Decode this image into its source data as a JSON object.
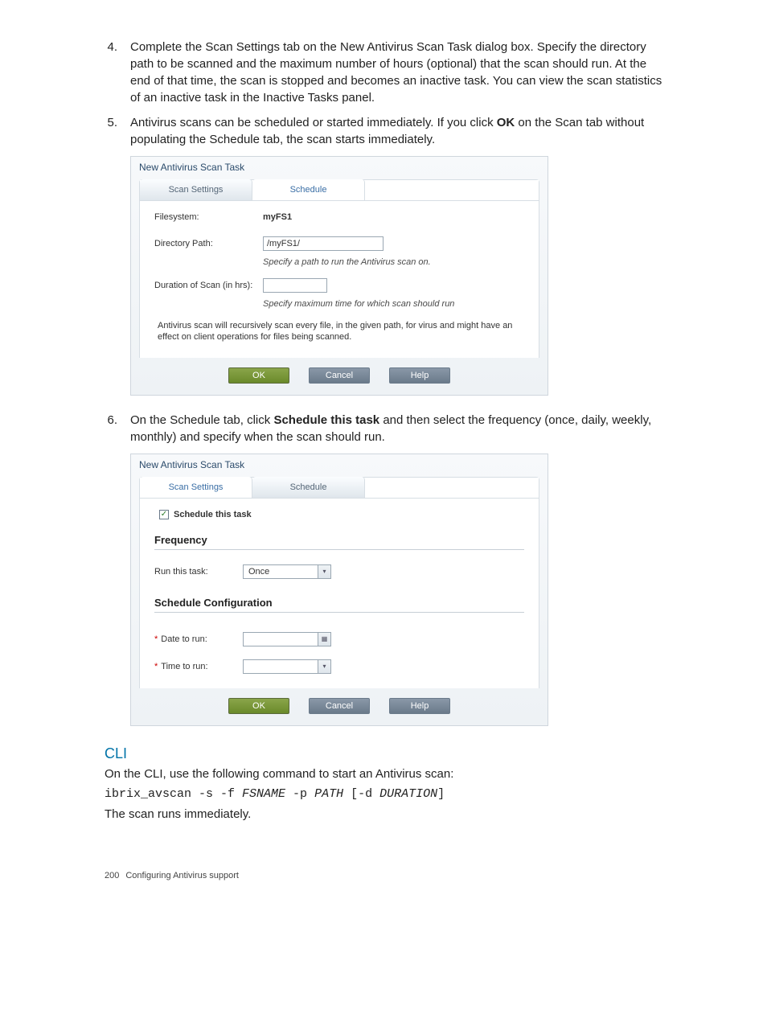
{
  "steps": {
    "s4": {
      "num": "4.",
      "text_a": "Complete the Scan Settings tab on the New Antivirus Scan Task dialog box. Specify the directory path to be scanned and the maximum number of hours (optional) that the scan should run. At the end of that time, the scan is stopped and becomes an inactive task. You can view the scan statistics of an inactive task in the Inactive Tasks panel."
    },
    "s5": {
      "num": "5.",
      "text_a": "Antivirus scans can be scheduled or started immediately. If you click ",
      "bold": "OK",
      "text_b": " on the Scan tab without populating the Schedule tab, the scan starts immediately."
    },
    "s6": {
      "num": "6.",
      "text_a": "On the Schedule tab, click ",
      "bold": "Schedule this task",
      "text_b": " and then select the frequency (once, daily, weekly, monthly) and specify when the scan should run."
    }
  },
  "dialog1": {
    "title": "New Antivirus Scan Task",
    "tab_settings": "Scan Settings",
    "tab_schedule": "Schedule",
    "filesystem_label": "Filesystem:",
    "filesystem_value": "myFS1",
    "dirpath_label": "Directory Path:",
    "dirpath_value": "/myFS1/",
    "dirpath_hint": "Specify a path to run the Antivirus scan on.",
    "duration_label": "Duration of Scan (in hrs):",
    "duration_value": "",
    "duration_hint": "Specify maximum time for which scan should run",
    "note": "Antivirus scan will recursively scan every file, in the given path, for virus and might have an effect on client operations for files being scanned.",
    "ok": "OK",
    "cancel": "Cancel",
    "help": "Help"
  },
  "dialog2": {
    "title": "New Antivirus Scan Task",
    "tab_settings": "Scan Settings",
    "tab_schedule": "Schedule",
    "schedule_checkbox_label": "Schedule this task",
    "schedule_checked": "✓",
    "freq_heading": "Frequency",
    "run_label": "Run this task:",
    "run_value": "Once",
    "config_heading": "Schedule Configuration",
    "date_label": "Date to run:",
    "time_label": "Time to run:",
    "ok": "OK",
    "cancel": "Cancel",
    "help": "Help",
    "chevron": "▾",
    "calendar": "▦",
    "asterisk": "*"
  },
  "cli": {
    "heading": "CLI",
    "intro": "On the CLI, use the following command to start an Antivirus scan:",
    "cmd_a": "ibrix_avscan -s -f ",
    "cmd_fs": "FSNAME",
    "cmd_b": " -p ",
    "cmd_path": "PATH",
    "cmd_c": " [-d ",
    "cmd_dur": "DURATION",
    "cmd_d": "]",
    "outro": "The scan runs immediately."
  },
  "footer": {
    "page": "200",
    "section": "Configuring Antivirus support"
  }
}
